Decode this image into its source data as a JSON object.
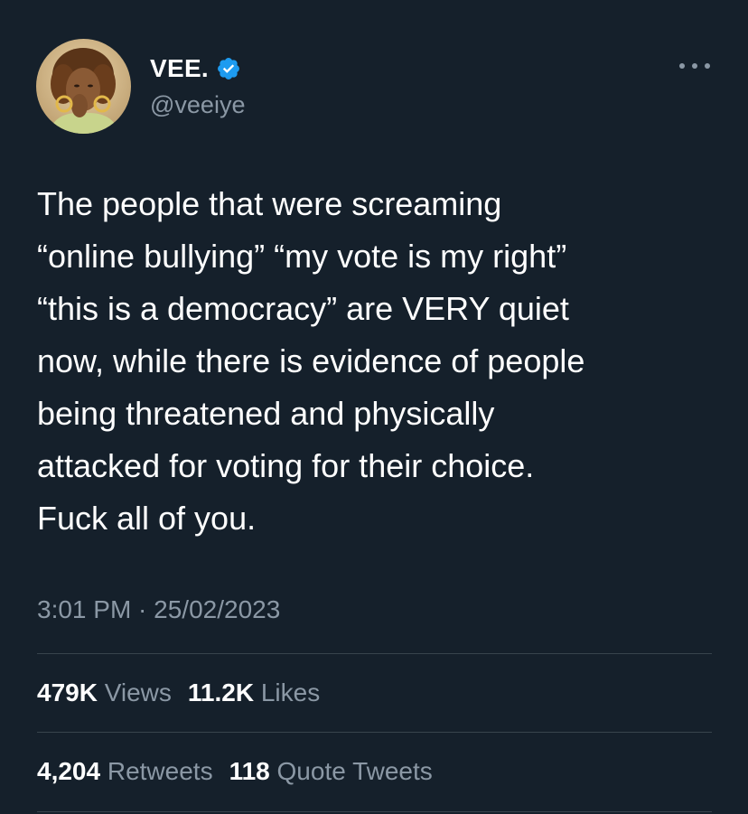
{
  "author": {
    "display_name": "VEE.",
    "handle": "@veeiye",
    "verified": true,
    "avatar_icon": "profile-photo",
    "verified_color": "#1d9bf0"
  },
  "tweet": {
    "lines": [
      "The people that were screaming",
      "“online bullying” “my vote is my right”",
      "“this is a democracy” are VERY quiet",
      "now, while there is evidence of people",
      "being threatened and physically",
      "attacked for voting for their choice.",
      "Fuck all of you."
    ],
    "timestamp": "3:01 PM · 25/02/2023"
  },
  "stats": {
    "views_count": "479K",
    "views_label": "Views",
    "likes_count": "11.2K",
    "likes_label": "Likes",
    "retweets_count": "4,204",
    "retweets_label": "Retweets",
    "quotes_count": "118",
    "quotes_label": "Quote Tweets"
  },
  "colors": {
    "background": "#15202b",
    "primary_text": "#ffffff",
    "secondary_text": "#8b98a5",
    "divider": "#38444d"
  }
}
